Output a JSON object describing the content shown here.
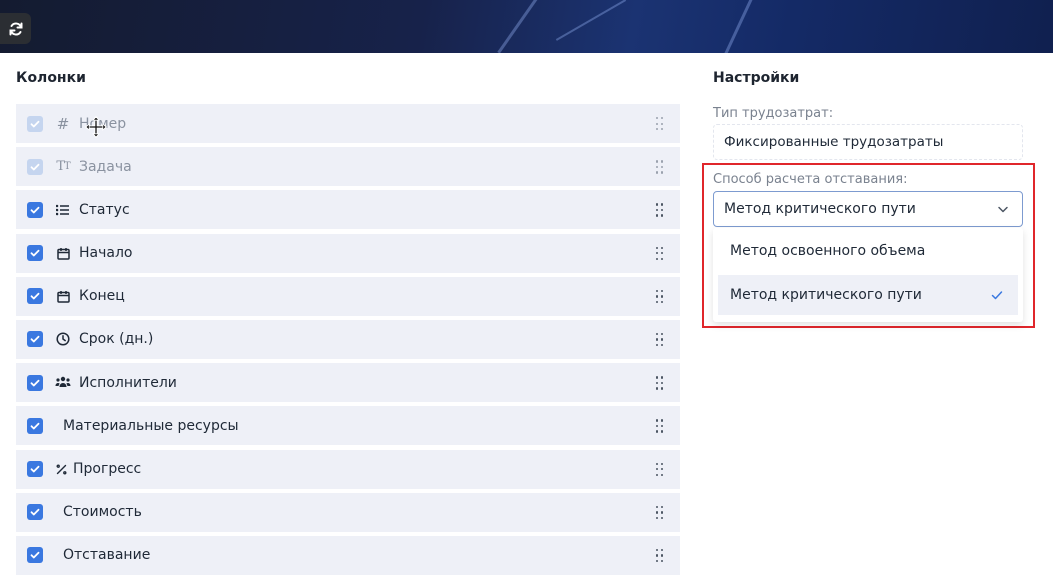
{
  "colors": {
    "accent": "#3a78e0",
    "highlight": "#e0262b",
    "row_bg": "#eef0f7"
  },
  "toolbar": {
    "refresh_icon": "refresh-icon"
  },
  "columns_panel": {
    "title": "Колонки",
    "rows": [
      {
        "label": "Номер",
        "icon": "hash-icon",
        "checked": true,
        "disabled": true
      },
      {
        "label": "Задача",
        "icon": "text-icon",
        "checked": true,
        "disabled": true
      },
      {
        "label": "Статус",
        "icon": "list-icon",
        "checked": true,
        "disabled": false
      },
      {
        "label": "Начало",
        "icon": "calendar-icon",
        "checked": true,
        "disabled": false
      },
      {
        "label": "Конец",
        "icon": "calendar-icon",
        "checked": true,
        "disabled": false
      },
      {
        "label": "Срок (дн.)",
        "icon": "clock-icon",
        "checked": true,
        "disabled": false
      },
      {
        "label": "Исполнители",
        "icon": "users-icon",
        "checked": true,
        "disabled": false
      },
      {
        "label": "Материальные ресурсы",
        "icon": "",
        "checked": true,
        "disabled": false
      },
      {
        "label": "Прогресс",
        "icon": "percent-icon",
        "checked": true,
        "disabled": false
      },
      {
        "label": "Стоимость",
        "icon": "",
        "checked": true,
        "disabled": false
      },
      {
        "label": "Отставание",
        "icon": "",
        "checked": true,
        "disabled": false
      }
    ]
  },
  "settings_panel": {
    "title": "Настройки",
    "labor_type": {
      "label": "Тип трудозатрат:",
      "value": "Фиксированные трудозатраты"
    },
    "lag_method": {
      "label": "Способ расчета отставания:",
      "value": "Метод критического пути",
      "options": [
        {
          "label": "Метод освоенного объема",
          "selected": false
        },
        {
          "label": "Метод критического пути",
          "selected": true
        }
      ]
    }
  }
}
